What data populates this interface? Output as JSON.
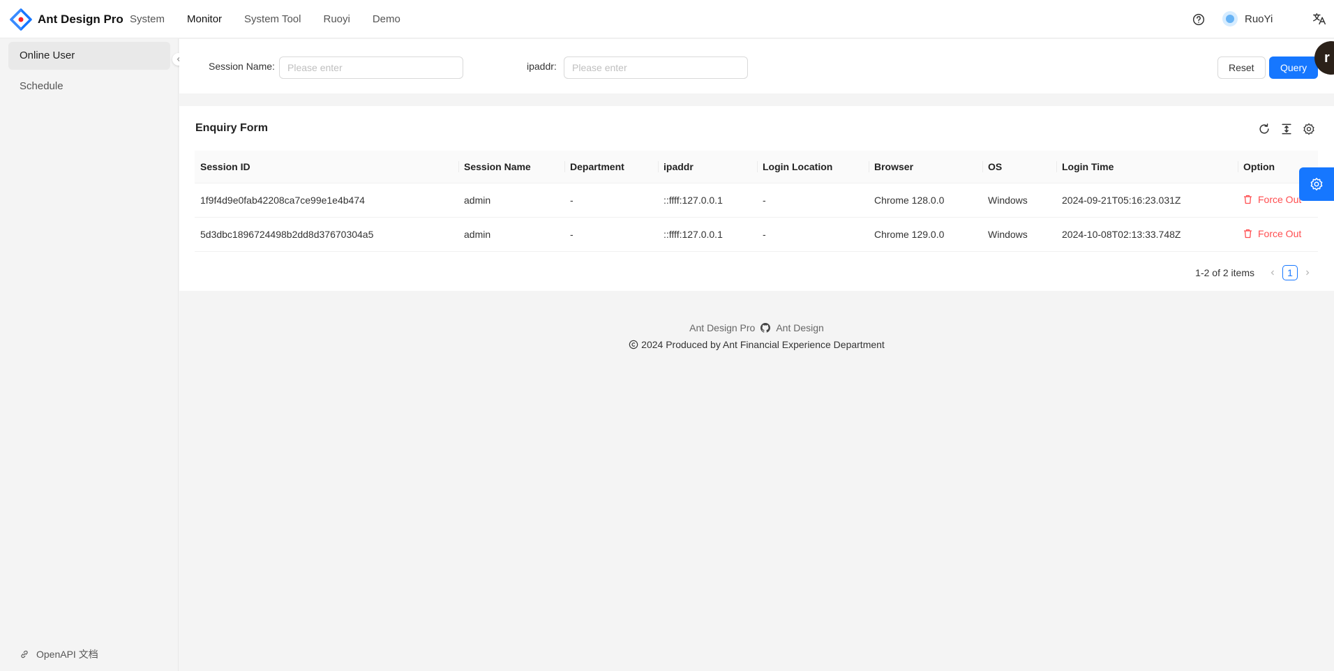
{
  "app": {
    "title": "Ant Design Pro"
  },
  "topnav": {
    "items": [
      {
        "label": "System",
        "active": false
      },
      {
        "label": "Monitor",
        "active": true
      },
      {
        "label": "System Tool",
        "active": false
      },
      {
        "label": "Ruoyi",
        "active": false
      },
      {
        "label": "Demo",
        "active": false
      }
    ]
  },
  "user": {
    "name": "RuoYi"
  },
  "icons": {
    "help": "question-circle-icon",
    "language": "translation-icon",
    "reload": "reload-icon",
    "density": "column-height-icon",
    "settings": "setting-icon"
  },
  "colors": {
    "primary": "#1677ff",
    "danger": "#ff4d4f"
  },
  "sidebar": {
    "items": [
      {
        "label": "Online User",
        "active": true
      },
      {
        "label": "Schedule",
        "active": false
      }
    ],
    "bottom_link": "OpenAPI 文档"
  },
  "search": {
    "session_name_label": "Session Name:",
    "session_name_placeholder": "Please enter",
    "ipaddr_label": "ipaddr:",
    "ipaddr_placeholder": "Please enter",
    "reset_label": "Reset",
    "query_label": "Query"
  },
  "table": {
    "title": "Enquiry Form",
    "columns": [
      "Session ID",
      "Session Name",
      "Department",
      "ipaddr",
      "Login Location",
      "Browser",
      "OS",
      "Login Time",
      "Option"
    ],
    "rows": [
      {
        "session_id": "1f9f4d9e0fab42208ca7ce99e1e4b474",
        "session_name": "admin",
        "department": "-",
        "ipaddr": "::ffff:127.0.0.1",
        "location": "-",
        "browser": "Chrome 128.0.0",
        "os": "Windows",
        "login_time": "2024-09-21T05:16:23.031Z",
        "option": "Force Out"
      },
      {
        "session_id": "5d3dbc1896724498b2dd8d37670304a5",
        "session_name": "admin",
        "department": "-",
        "ipaddr": "::ffff:127.0.0.1",
        "location": "-",
        "browser": "Chrome 129.0.0",
        "os": "Windows",
        "login_time": "2024-10-08T02:13:33.748Z",
        "option": "Force Out"
      }
    ]
  },
  "pagination": {
    "summary": "1-2 of 2 items",
    "current_page": "1"
  },
  "footer": {
    "link1": "Ant Design Pro",
    "link2": "Ant Design",
    "copyright": "2024 Produced by Ant Financial Experience Department"
  },
  "floating": {
    "avatar_letter": "r"
  }
}
